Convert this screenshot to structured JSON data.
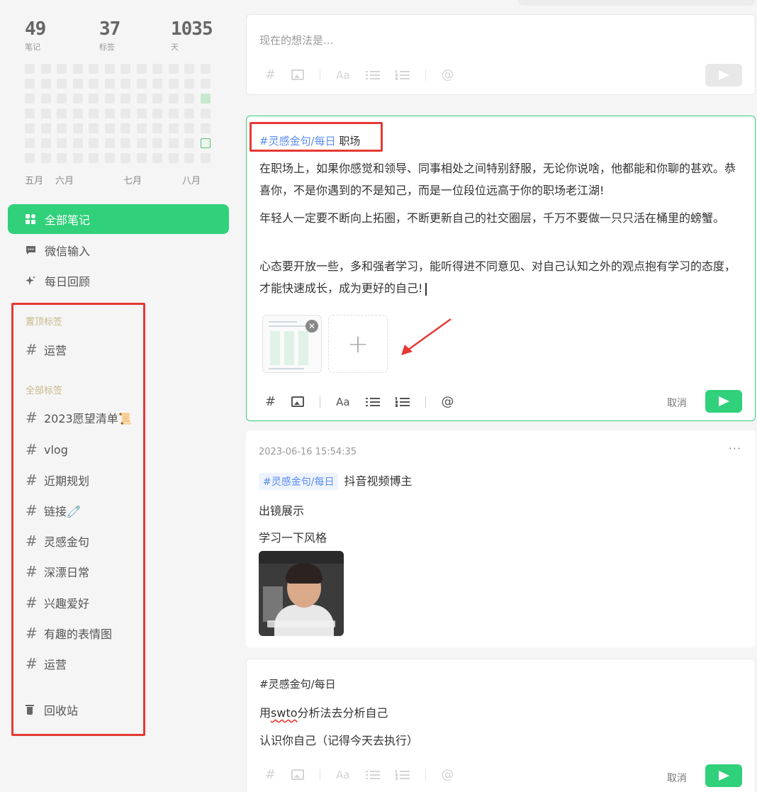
{
  "stats": [
    {
      "num": "49",
      "label": "笔记"
    },
    {
      "num": "37",
      "label": "标签"
    },
    {
      "num": "1035",
      "label": "天"
    }
  ],
  "heatmap": {
    "rows": 7,
    "cols": 12,
    "active_cells": [
      {
        "row": 2,
        "col": 11
      }
    ],
    "today_cell": {
      "row": 5,
      "col": 11
    }
  },
  "months": [
    "五月",
    "六月",
    "七月",
    "八月"
  ],
  "nav": [
    {
      "label": "全部笔记",
      "icon": "grid-icon"
    },
    {
      "label": "微信输入",
      "icon": "chat-icon"
    },
    {
      "label": "每日回顾",
      "icon": "sparkle-icon"
    }
  ],
  "pinned": {
    "title": "置顶标签",
    "tags": [
      "运营"
    ]
  },
  "all_tags": {
    "title": "全部标签",
    "tags": [
      "2023愿望清单📜",
      "vlog",
      "近期规划",
      "链接🧷",
      "灵感金句",
      "深漂日常",
      "兴趣爱好",
      "有趣的表情图",
      "运营"
    ]
  },
  "trash_label": "回收站",
  "composer": {
    "placeholder": "现在的想法是..."
  },
  "toolbar": {
    "hash": "#",
    "font": "Aa",
    "at": "@"
  },
  "editor": {
    "tag": "#灵感金句/每日",
    "tag_suffix": "职场",
    "paragraphs": [
      "在职场上，如果你感觉和领导、同事相处之间特别舒服，无论你说啥，他都能和你聊的甚欢。恭喜你，不是你遇到的不是知己，而是一位段位远高于你的职场老江湖!",
      "年轻人一定要不断向上拓圈，不断更新自己的社交圈层，千万不要做一只只活在桶里的螃蟹。",
      "心态要开放一些，多和强者学习，能听得进不同意见、对自己认知之外的观点抱有学习的态度，才能快速成长，成为更好的自己!"
    ],
    "add_label": "+",
    "cancel": "取消"
  },
  "note1": {
    "timestamp": "2023-06-16 15:54:35",
    "more": "···",
    "tag": "#灵感金句/每日",
    "tag_suffix": "抖音视频博主",
    "lines": [
      "出镜展示",
      "学习一下风格"
    ]
  },
  "note2": {
    "tag": "#灵感金句/每日",
    "line1_pre": "用",
    "line1_mark": "swto",
    "line1_post": "分析法去分析自己",
    "line2": "认识你自己（记得今天去执行）",
    "cancel": "取消"
  },
  "colors": {
    "accent": "#31d07a",
    "tag": "#5b8def",
    "highlight": "#e53935"
  }
}
